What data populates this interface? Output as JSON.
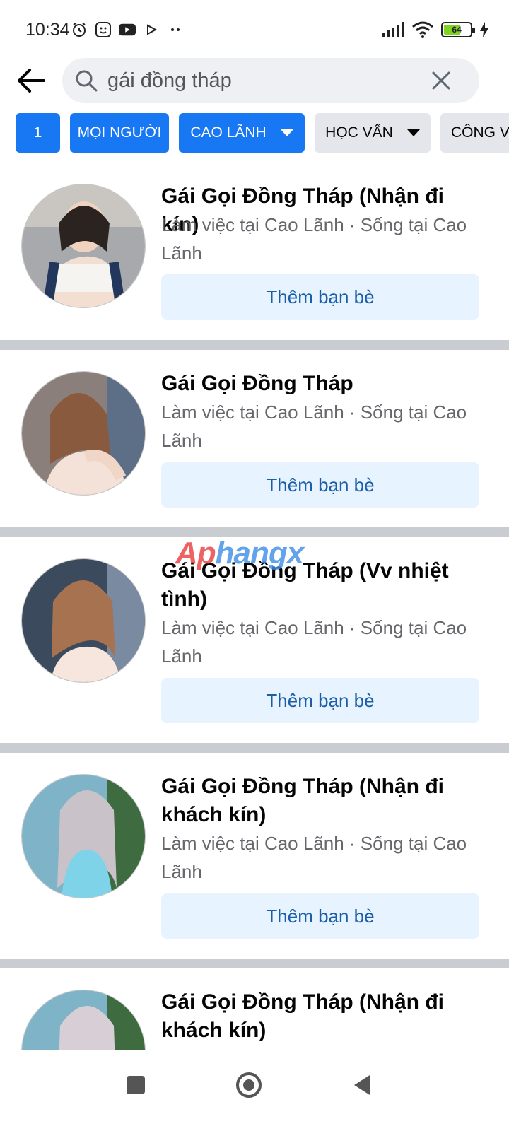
{
  "status_bar": {
    "time": "10:34",
    "battery_level": "64",
    "battery_fraction": 0.64,
    "left_icons": [
      "alarm-icon",
      "face-icon",
      "youtube-icon",
      "play-icon",
      "more-dots-icon"
    ],
    "right_icons": [
      "signal-icon",
      "wifi-icon",
      "battery-icon",
      "charging-icon"
    ]
  },
  "search": {
    "query": "gái đồng tháp",
    "back_icon": "back-arrow-icon",
    "search_icon": "search-icon",
    "clear_icon": "clear-icon"
  },
  "filters": [
    {
      "label": "1",
      "style": "blue",
      "dropdown": false
    },
    {
      "label": "MỌI NGƯỜI",
      "style": "blue",
      "dropdown": false
    },
    {
      "label": "CAO LÃNH",
      "style": "blue",
      "dropdown": true
    },
    {
      "label": "HỌC VẤN",
      "style": "gray",
      "dropdown": true
    },
    {
      "label": "CÔNG V",
      "style": "gray",
      "dropdown": false
    }
  ],
  "results": [
    {
      "name": "Gái Gọi Đồng Tháp (Nhận đi kín)",
      "meta": "Làm việc tại Cao Lãnh · Sống tại Cao Lãnh",
      "button": "Thêm bạn bè"
    },
    {
      "name": "Gái Gọi Đồng Tháp",
      "meta": "Làm việc tại Cao Lãnh · Sống tại Cao Lãnh",
      "button": "Thêm bạn bè"
    },
    {
      "name": "Gái Gọi Đồng Tháp (Vv nhiệt tình)",
      "meta": "Làm việc tại Cao Lãnh · Sống tại Cao Lãnh",
      "button": "Thêm bạn bè"
    },
    {
      "name": "Gái Gọi Đồng Tháp (Nhận đi khách kín)",
      "meta": "Làm việc tại Cao Lãnh · Sống tại Cao Lãnh",
      "button": "Thêm bạn bè"
    },
    {
      "name": "Gái Gọi Đồng Tháp (Nhận đi khách kín)",
      "meta": "",
      "button": ""
    }
  ],
  "watermark": {
    "part1": "Ap",
    "part2": "hangx"
  },
  "nav": {
    "recents_icon": "square-icon",
    "home_icon": "home-circle-icon",
    "back_icon": "triangle-back-icon"
  },
  "colors": {
    "accent": "#1877f2",
    "chip_gray": "#e4e6eb",
    "add_button_bg": "#e7f3ff",
    "add_button_text": "#1b5ea8",
    "divider": "#c9ccd1",
    "secondary_text": "#65676b"
  }
}
